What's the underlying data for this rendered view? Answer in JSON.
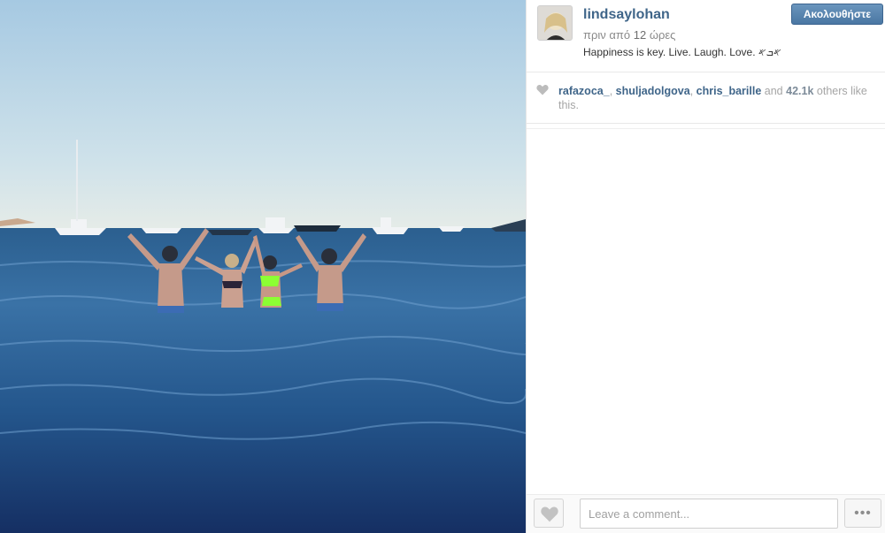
{
  "post": {
    "username": "lindsaylohan",
    "time_prefix": "πριν από",
    "time_number": "12",
    "time_suffix": "ώρες",
    "caption": "Happiness is key. Live. Laugh. Love. 𐤀ܒ𐤀",
    "follow_label": "Ακολουθήστε"
  },
  "likes": {
    "users": [
      "rafazoca_",
      "shuljadolgova",
      "chris_barille"
    ],
    "and_text": "and",
    "count": "42.1k",
    "suffix": "others like this."
  },
  "comment": {
    "placeholder": "Leave a comment..."
  },
  "more_label": "•••",
  "icons": {
    "like": "heart-icon",
    "more": "ellipsis-icon"
  },
  "colors": {
    "link": "#3f6589",
    "follow_button": "#4a77a3"
  }
}
